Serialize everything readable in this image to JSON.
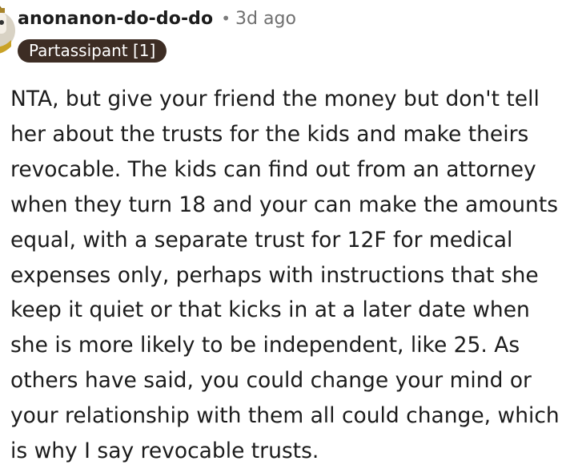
{
  "comment": {
    "author": "anonanon-do-do-do",
    "separator": "•",
    "timestamp": "3d ago",
    "flair": "Partassipant [1]",
    "avatar_icon": "snoo-avatar-icon",
    "body_lines": [
      "NTA, but give your friend the money but don't tell",
      "her about the trusts for the kids and make theirs",
      "revocable. The kids can find out from an attorney",
      "when they turn 18 and your can make the amounts",
      "equal, with a separate trust for 12F for medical",
      "expenses only, perhaps with instructions that she",
      "keep it quiet or that kicks in at a later date when",
      "she is more likely to be independent, like 25. As",
      "others have said, you could change your mind or",
      "your relationship with them all could change, which",
      "is why I say revocable trusts."
    ]
  },
  "colors": {
    "flair_bg": "#3d2d24",
    "flair_text": "#ffffff",
    "text": "#1c1c1c",
    "meta": "#6f6f6f"
  }
}
